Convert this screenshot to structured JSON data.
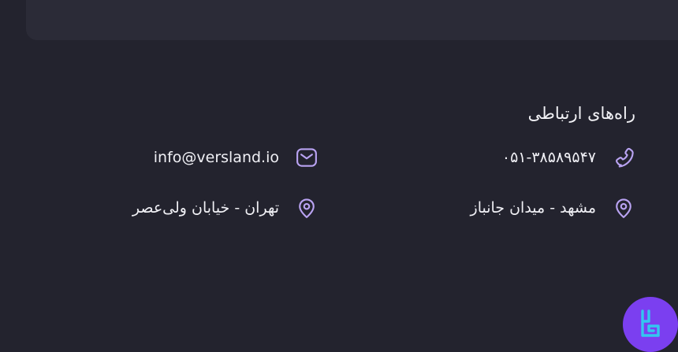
{
  "contact": {
    "title": "راه‌های ارتباطی",
    "phone": "۰۵۱-۳۸۵۸۹۵۴۷",
    "email": "info@versland.io",
    "address_mashhad": "مشهد - میدان جانباز",
    "address_tehran": "تهران - خیابان ولی‌عصر"
  },
  "icons": {
    "phone": "phone-icon",
    "email": "envelope-icon",
    "location": "map-pin-icon",
    "logo": "brand-logo-icon"
  },
  "colors": {
    "background": "#23232e",
    "card": "#2b2b37",
    "icon_accent": "#b9a3f2",
    "logo_background": "#7b3ff0",
    "logo_mark": "#33c6f0",
    "text": "#f0f0f5"
  }
}
